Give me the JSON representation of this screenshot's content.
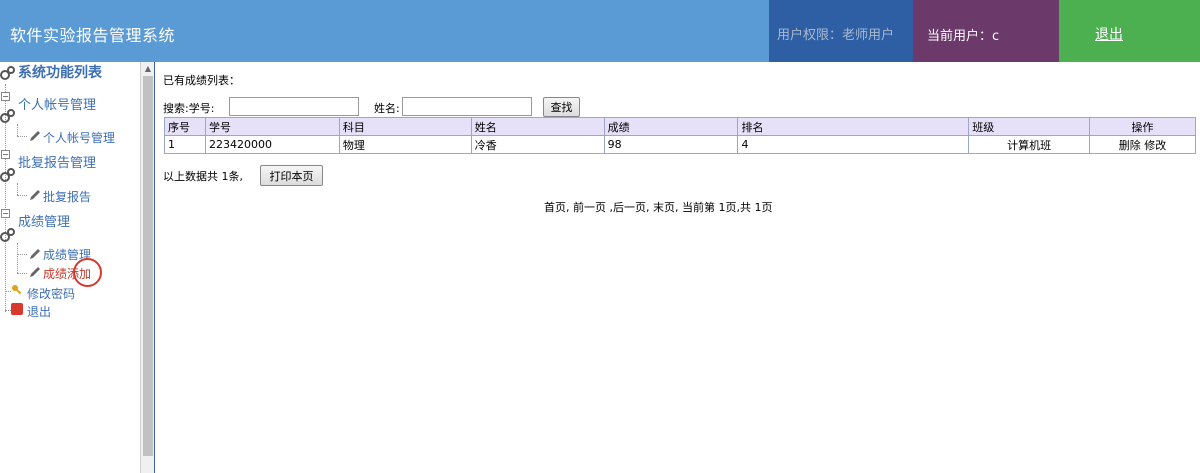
{
  "header": {
    "title": "软件实验报告管理系统",
    "permission": "用户权限：老师用户",
    "current_user": "当前用户：c",
    "logout": "退出"
  },
  "sidebar": {
    "title": "系统功能列表",
    "groups": [
      {
        "label": "个人帐号管理",
        "items": [
          "个人帐号管理"
        ]
      },
      {
        "label": "批复报告管理",
        "items": [
          "批复报告"
        ]
      },
      {
        "label": "成绩管理",
        "items": [
          "成绩管理",
          "成绩添加"
        ]
      }
    ],
    "change_password": "修改密码",
    "exit": "退出"
  },
  "main": {
    "section_title": "已有成绩列表：",
    "search": {
      "label_id": "搜索:学号:",
      "id_value": "",
      "label_name": "姓名:",
      "name_value": "",
      "button": "查找"
    },
    "table": {
      "columns": [
        "序号",
        "学号",
        "科目",
        "姓名",
        "成绩",
        "排名",
        "班级",
        "操作"
      ],
      "rows": [
        {
          "seq": "1",
          "id": "223420000",
          "subject": "物理",
          "name": "冷香",
          "score": "98",
          "rank": "4",
          "class": "计算机班",
          "delete": "删除",
          "edit": "修改"
        }
      ]
    },
    "total_text": "以上数据共 1条,",
    "print_button": "打印本页",
    "pager": "首页, 前一页 ,后一页, 末页, 当前第 1页,共 1页"
  }
}
